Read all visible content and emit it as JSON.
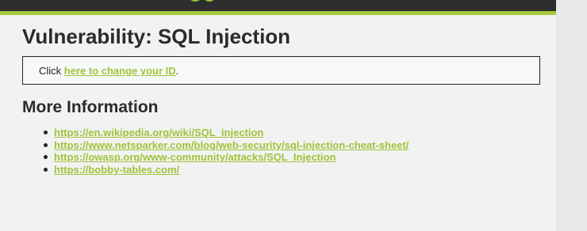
{
  "header": {
    "logo_icon": "dvwa-logo-icon"
  },
  "colors": {
    "header_bg": "#2e2e2e",
    "accent": "#a6c83c",
    "link": "#a0c33a",
    "content_bg": "#f2f2f2"
  },
  "main": {
    "title": "Vulnerability: SQL Injection",
    "box": {
      "prefix": "Click ",
      "link_text": "here to change your ID",
      "suffix": "."
    },
    "more_info": {
      "heading": "More Information",
      "links": [
        "https://en.wikipedia.org/wiki/SQL_injection",
        "https://www.netsparker.com/blog/web-security/sql-injection-cheat-sheet/",
        "https://owasp.org/www-community/attacks/SQL_Injection",
        "https://bobby-tables.com/"
      ]
    }
  }
}
